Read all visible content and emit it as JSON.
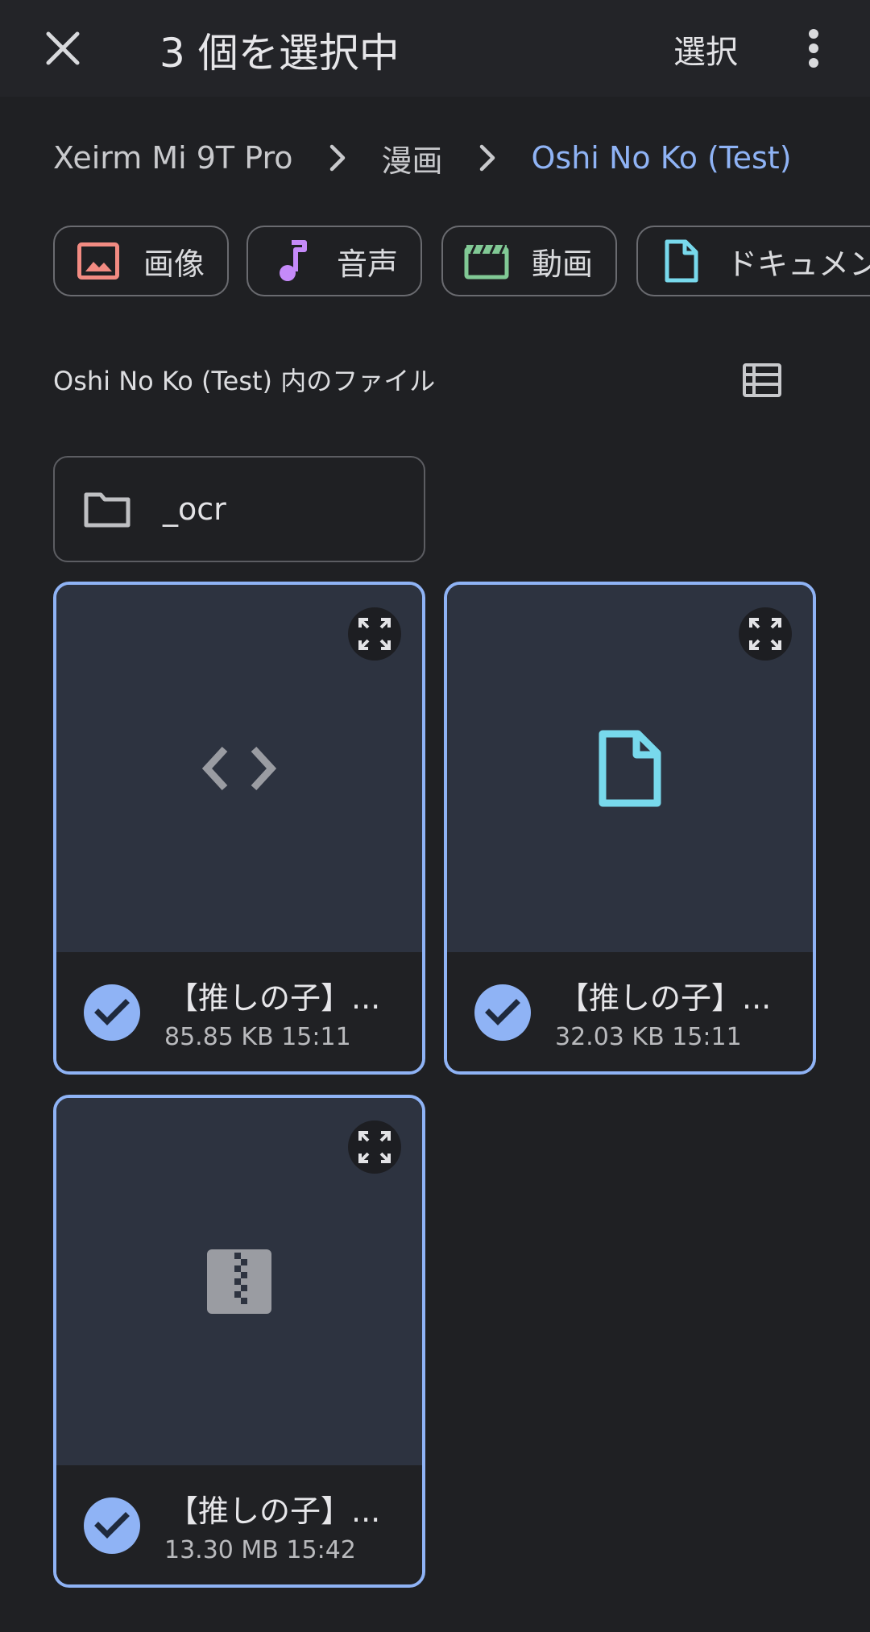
{
  "header": {
    "title": "3 個を選択中",
    "select_label": "選択",
    "close_icon": "close-icon",
    "more_icon": "more-vert-icon"
  },
  "breadcrumb": {
    "items": [
      "Xeirm Mi 9T Pro",
      "漫画",
      "Oshi No Ko (Test)"
    ]
  },
  "filters": [
    {
      "label": "画像",
      "icon": "image-icon",
      "color": "#f28b82"
    },
    {
      "label": "音声",
      "icon": "music-note-icon",
      "color": "#c58af9"
    },
    {
      "label": "動画",
      "icon": "movie-icon",
      "color": "#81c995"
    },
    {
      "label": "ドキュメント",
      "icon": "document-icon",
      "color": "#78d9ec"
    }
  ],
  "section": {
    "label": "Oshi No Ko (Test) 内のファイル",
    "view_icon": "list-view-icon"
  },
  "folders": [
    {
      "name": "_ocr",
      "icon": "folder-icon"
    }
  ],
  "files": [
    {
      "name": "【推しの子】...",
      "size": "85.85 KB",
      "time": "15:11",
      "meta": "85.85 KB 15:11",
      "icon": "code-icon",
      "selected": true
    },
    {
      "name": "【推しの子】...",
      "size": "32.03 KB",
      "time": "15:11",
      "meta": "32.03 KB 15:11",
      "icon": "document-icon",
      "selected": true
    },
    {
      "name": "【推しの子】...",
      "size": "13.30 MB",
      "time": "15:42",
      "meta": "13.30 MB 15:42",
      "icon": "archive-icon",
      "selected": true
    }
  ],
  "colors": {
    "accent": "#8fb3f5",
    "background": "#1f2023",
    "thumb_bg": "#2d3340"
  }
}
